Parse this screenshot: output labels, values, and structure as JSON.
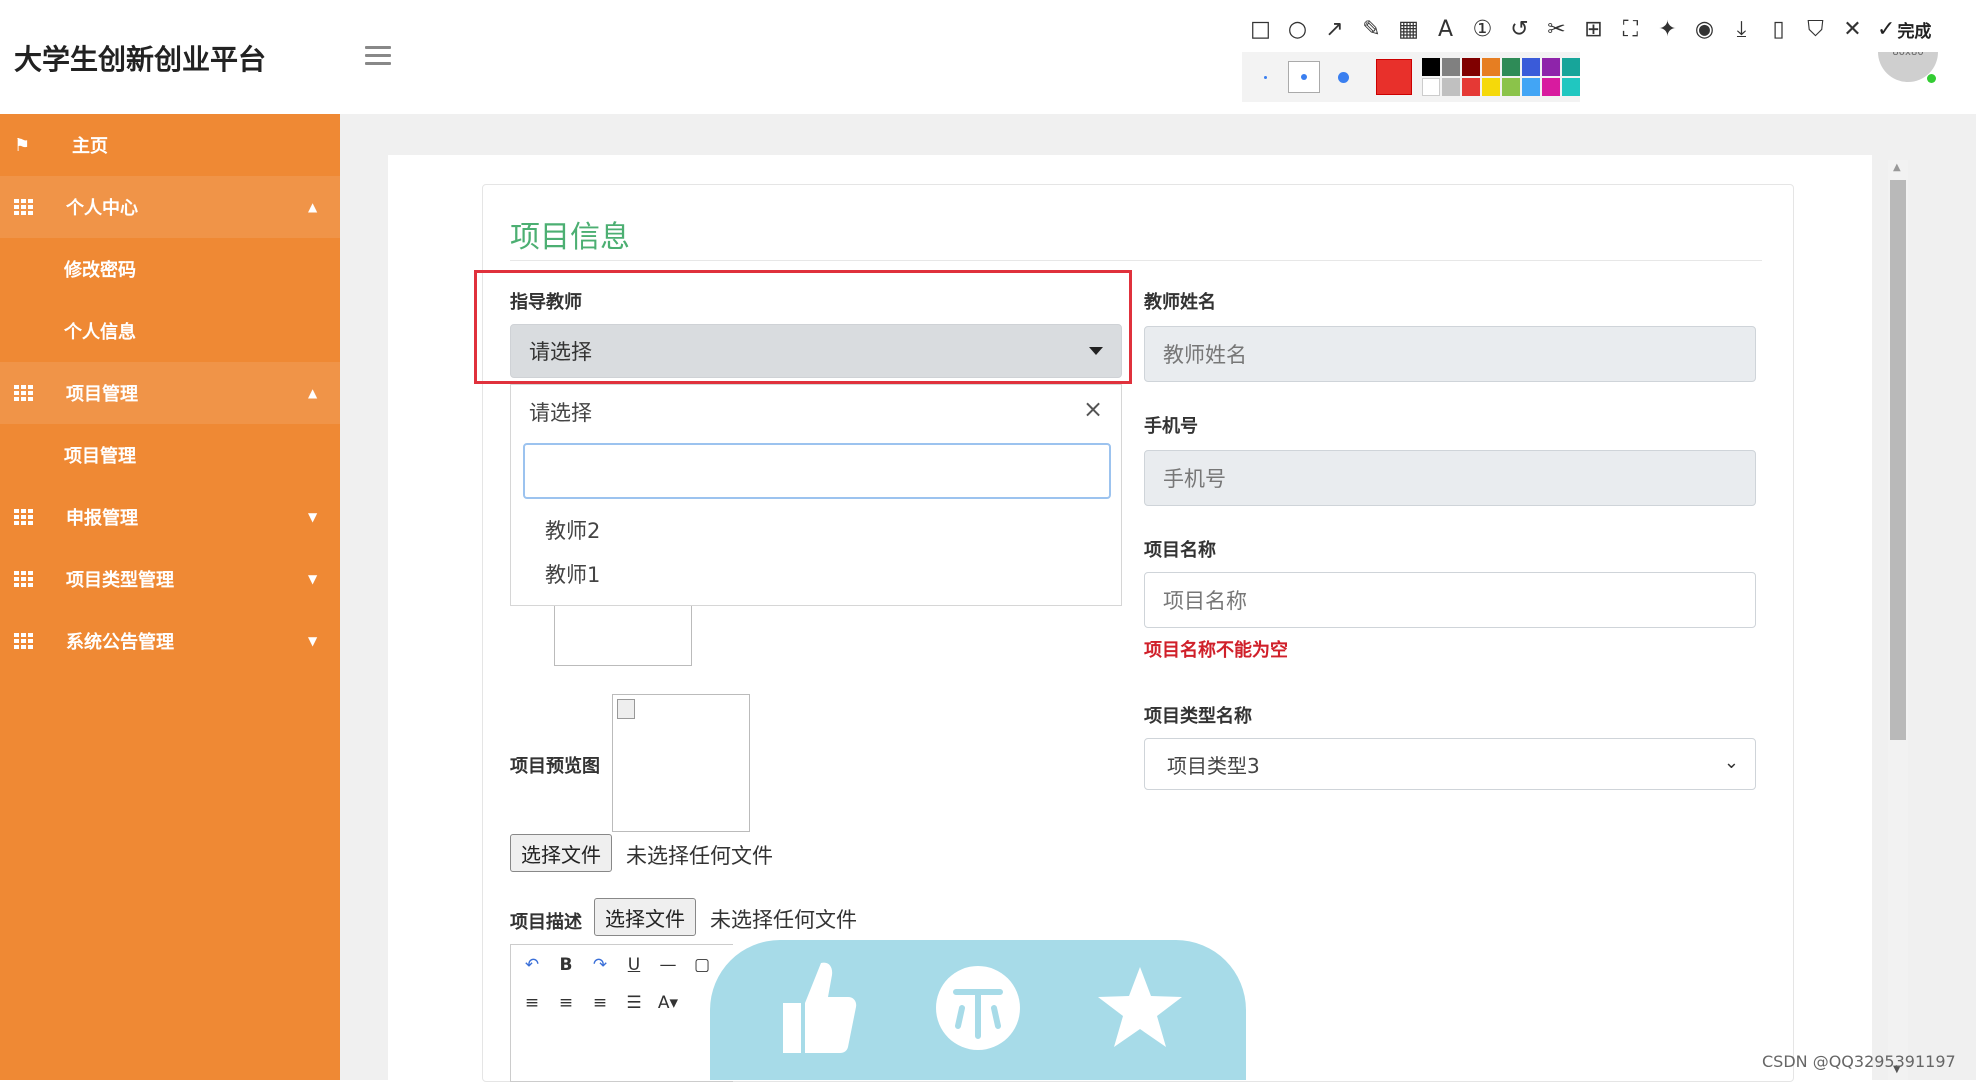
{
  "app": {
    "title": "大学生创新创业平台",
    "avatar_text": "80x80"
  },
  "screenshot_tool": {
    "done_label": "完成",
    "current_color": "#e8302b",
    "palette": [
      "#000000",
      "#808080",
      "#800000",
      "#e67e22",
      "#2e8b57",
      "#3a5bd9",
      "#8e24aa",
      "#17a59a",
      "#ffffff",
      "#c0c0c0",
      "#e53935",
      "#f5d90a",
      "#8bc34a",
      "#42a5f5",
      "#d81b9f",
      "#20c7c0"
    ]
  },
  "sidebar": {
    "home": "主页",
    "personal_center": "个人中心",
    "change_password": "修改密码",
    "personal_info": "个人信息",
    "project_mgmt": "项目管理",
    "project_mgmt_sub": "项目管理",
    "report_mgmt": "申报管理",
    "project_type_mgmt": "项目类型管理",
    "announcement_mgmt": "系统公告管理"
  },
  "form": {
    "section_title": "项目信息",
    "advisor_label": "指导教师",
    "advisor_selected": "请选择",
    "dropdown": {
      "header": "请选择",
      "search_value": "",
      "options": [
        "教师2",
        "教师1"
      ]
    },
    "teacher_name_label": "教师姓名",
    "teacher_name_placeholder": "教师姓名",
    "phone_label": "手机号",
    "phone_placeholder": "手机号",
    "project_name_label": "项目名称",
    "project_name_placeholder": "项目名称",
    "project_name_error": "项目名称不能为空",
    "project_type_label": "项目类型名称",
    "project_type_value": "项目类型3",
    "preview_label": "项目预览图",
    "choose_file": "选择文件",
    "no_file": "未选择任何文件",
    "desc_label": "项目描述",
    "desc_choose_file": "选择文件",
    "desc_no_file": "未选择任何文件"
  },
  "watermark": "CSDN @QQ3295391197"
}
